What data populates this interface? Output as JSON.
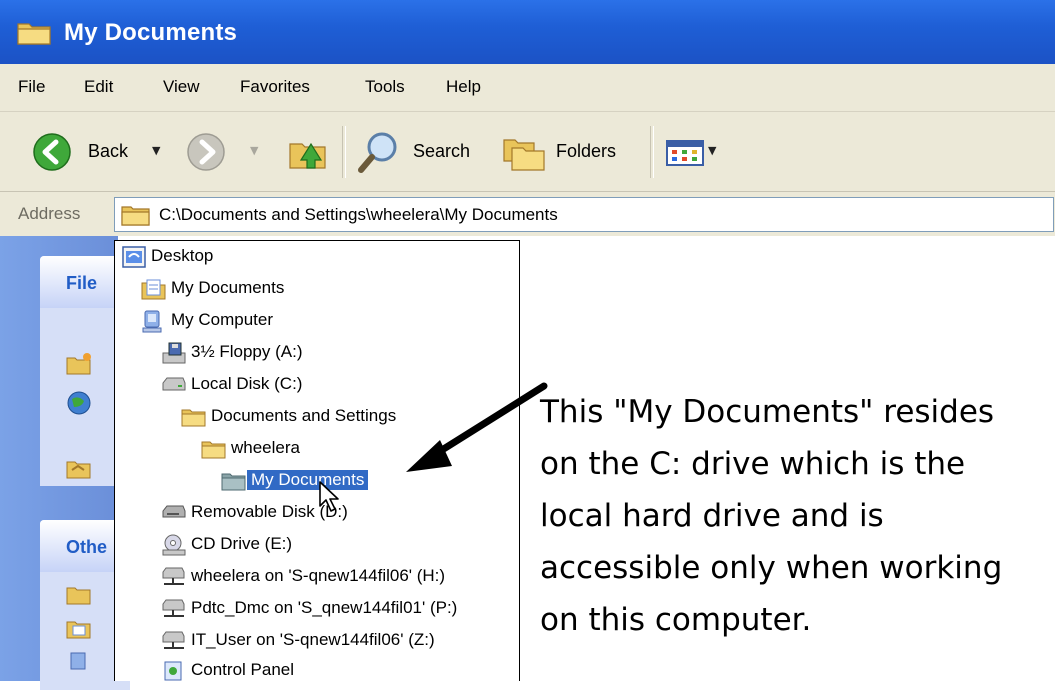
{
  "window": {
    "title": "My Documents"
  },
  "menu": [
    "File",
    "Edit",
    "View",
    "Favorites",
    "Tools",
    "Help"
  ],
  "toolbar": {
    "back_label": "Back",
    "search_label": "Search",
    "folders_label": "Folders"
  },
  "address": {
    "label": "Address",
    "value": "C:\\Documents and Settings\\wheelera\\My Documents"
  },
  "task_pane": {
    "file_tasks_heading": "File",
    "other_places_heading": "Othe"
  },
  "dropdown": {
    "items": [
      {
        "label": "Desktop",
        "icon": "desktop-icon"
      },
      {
        "label": "My Documents",
        "icon": "my-documents-icon"
      },
      {
        "label": "My Computer",
        "icon": "my-computer-icon"
      },
      {
        "label": "3½ Floppy (A:)",
        "icon": "floppy-drive-icon"
      },
      {
        "label": "Local Disk (C:)",
        "icon": "local-disk-icon"
      },
      {
        "label": "Documents and Settings",
        "icon": "folder-icon"
      },
      {
        "label": "wheelera",
        "icon": "folder-icon"
      },
      {
        "label": "My Documents",
        "icon": "folder-icon",
        "selected": true
      },
      {
        "label": "Removable Disk (D:)",
        "icon": "removable-disk-icon"
      },
      {
        "label": "CD Drive (E:)",
        "icon": "cd-drive-icon"
      },
      {
        "label": "wheelera on 'S-qnew144fil06' (H:)",
        "icon": "network-drive-icon"
      },
      {
        "label": "Pdtc_Dmc on 'S_qnew144fil01' (P:)",
        "icon": "network-drive-icon"
      },
      {
        "label": "IT_User on 'S-qnew144fil06' (Z:)",
        "icon": "network-drive-icon"
      },
      {
        "label": "Control Panel",
        "icon": "control-panel-icon"
      }
    ]
  },
  "annotation": {
    "lines": [
      "This \"My Documents\" resides",
      "on the C: drive which is the",
      "local hard drive and is",
      "accessible only when working",
      "on this computer."
    ]
  }
}
